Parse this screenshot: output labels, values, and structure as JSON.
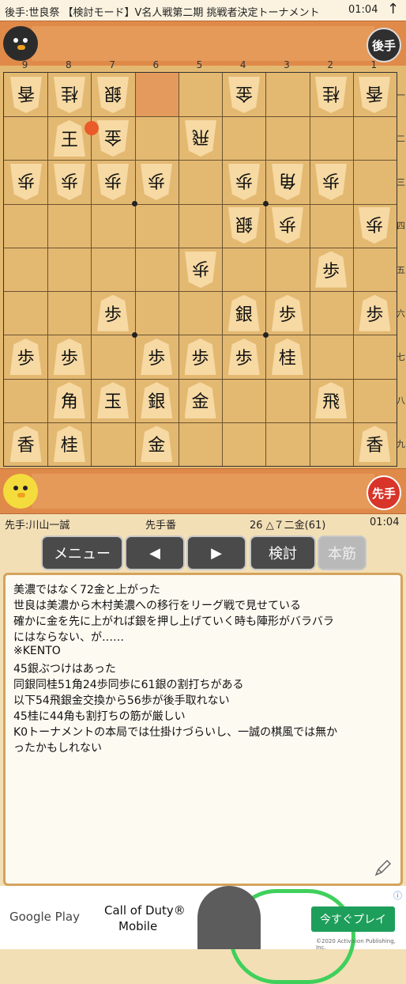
{
  "header": {
    "title": "後手:世良祭 【検討モード】V名人戦第二期 挑戦者決定トーナメント",
    "time": "01:04",
    "up_icon": "↑"
  },
  "players": {
    "gote_badge": "後手",
    "sente_badge": "先手"
  },
  "board": {
    "files": [
      "9",
      "8",
      "7",
      "6",
      "5",
      "4",
      "3",
      "2",
      "1"
    ],
    "ranks": [
      "一",
      "二",
      "三",
      "四",
      "五",
      "六",
      "七",
      "八",
      "九"
    ],
    "last_move_marker": "7二"
  },
  "pieces": [
    {
      "label": "香",
      "side": "gote",
      "file": 9,
      "rank": 1
    },
    {
      "label": "桂",
      "side": "gote",
      "file": 8,
      "rank": 1
    },
    {
      "label": "銀",
      "side": "gote",
      "file": 7,
      "rank": 1
    },
    {
      "label": "金",
      "side": "gote",
      "file": 4,
      "rank": 1
    },
    {
      "label": "桂",
      "side": "gote",
      "file": 2,
      "rank": 1
    },
    {
      "label": "香",
      "side": "gote",
      "file": 1,
      "rank": 1
    },
    {
      "label": "王",
      "side": "sente-face",
      "file": 8,
      "rank": 2
    },
    {
      "label": "金",
      "side": "gote",
      "file": 7,
      "rank": 2
    },
    {
      "label": "飛",
      "side": "gote",
      "file": 5,
      "rank": 2
    },
    {
      "label": "歩",
      "side": "gote",
      "file": 9,
      "rank": 3
    },
    {
      "label": "歩",
      "side": "gote",
      "file": 8,
      "rank": 3
    },
    {
      "label": "歩",
      "side": "gote",
      "file": 7,
      "rank": 3
    },
    {
      "label": "歩",
      "side": "gote",
      "file": 6,
      "rank": 3
    },
    {
      "label": "歩",
      "side": "gote",
      "file": 4,
      "rank": 3
    },
    {
      "label": "角",
      "side": "gote",
      "file": 3,
      "rank": 3
    },
    {
      "label": "歩",
      "side": "gote",
      "file": 2,
      "rank": 3
    },
    {
      "label": "銀",
      "side": "gote",
      "file": 4,
      "rank": 4
    },
    {
      "label": "歩",
      "side": "gote",
      "file": 3,
      "rank": 4
    },
    {
      "label": "歩",
      "side": "gote",
      "file": 1,
      "rank": 4
    },
    {
      "label": "歩",
      "side": "gote",
      "file": 5,
      "rank": 5
    },
    {
      "label": "歩",
      "side": "sente",
      "file": 2,
      "rank": 5
    },
    {
      "label": "歩",
      "side": "sente",
      "file": 7,
      "rank": 6
    },
    {
      "label": "銀",
      "side": "sente",
      "file": 4,
      "rank": 6
    },
    {
      "label": "歩",
      "side": "sente",
      "file": 3,
      "rank": 6
    },
    {
      "label": "歩",
      "side": "sente",
      "file": 1,
      "rank": 6
    },
    {
      "label": "歩",
      "side": "sente",
      "file": 9,
      "rank": 7
    },
    {
      "label": "歩",
      "side": "sente",
      "file": 8,
      "rank": 7
    },
    {
      "label": "歩",
      "side": "sente",
      "file": 6,
      "rank": 7
    },
    {
      "label": "歩",
      "side": "sente",
      "file": 5,
      "rank": 7
    },
    {
      "label": "歩",
      "side": "sente",
      "file": 4,
      "rank": 7
    },
    {
      "label": "桂",
      "side": "sente",
      "file": 3,
      "rank": 7
    },
    {
      "label": "角",
      "side": "sente",
      "file": 8,
      "rank": 8
    },
    {
      "label": "玉",
      "side": "sente",
      "file": 7,
      "rank": 8
    },
    {
      "label": "銀",
      "side": "sente",
      "file": 6,
      "rank": 8
    },
    {
      "label": "金",
      "side": "sente",
      "file": 5,
      "rank": 8
    },
    {
      "label": "飛",
      "side": "sente",
      "file": 2,
      "rank": 8
    },
    {
      "label": "香",
      "side": "sente",
      "file": 9,
      "rank": 9
    },
    {
      "label": "桂",
      "side": "sente",
      "file": 8,
      "rank": 9
    },
    {
      "label": "金",
      "side": "sente",
      "file": 6,
      "rank": 9
    },
    {
      "label": "香",
      "side": "sente",
      "file": 1,
      "rank": 9
    }
  ],
  "status": {
    "sente_player": "先手:川山一誠",
    "turn": "先手番",
    "move": "26 △７二金(61)",
    "time": "01:04"
  },
  "controls": {
    "menu": "メニュー",
    "prev": "◀",
    "next": "▶",
    "analyze": "検討",
    "mainline": "本筋"
  },
  "comment": {
    "lines": [
      "美濃ではなく72金と上がった",
      "世良は美濃から木村美濃への移行をリーグ戦で見せている",
      "確かに金を先に上がれば銀を押し上げていく時も陣形がバラバラ",
      "にはならない、が……",
      "※KENTO",
      "45銀ぶつけはあった",
      "同銀同桂51角24歩同歩に61銀の割打ちがある",
      "以下54飛銀金交換から56歩が後手取れない",
      "45桂に44角も割打ちの筋が厳しい",
      "K0トーナメントの本局では仕掛けづらいし、一誠の棋風では無か",
      "ったかもしれない"
    ]
  },
  "ad": {
    "store": "Google Play",
    "title_line1": "Call of Duty®",
    "title_line2": "Mobile",
    "cta": "今すぐプレイ",
    "copyright": "©2020 Activision Publishing, Inc.",
    "info": "ⓘ"
  }
}
